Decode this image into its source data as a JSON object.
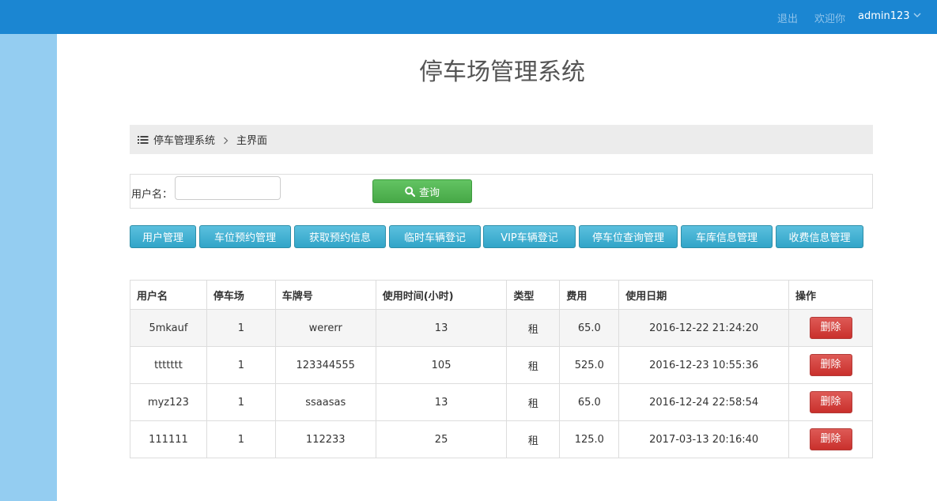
{
  "header": {
    "logout": "退出",
    "welcome": "欢迎你",
    "username": "admin123"
  },
  "page": {
    "title": "停车场管理系统"
  },
  "breadcrumb": {
    "root": "停车管理系统",
    "current": "主界面"
  },
  "search": {
    "label": "用户名：",
    "value": "",
    "button": "查询"
  },
  "nav": [
    {
      "label": "用户管理"
    },
    {
      "label": "车位预约管理"
    },
    {
      "label": "获取预约信息"
    },
    {
      "label": "临时车辆登记"
    },
    {
      "label": "VIP车辆登记"
    },
    {
      "label": "停车位查询管理"
    },
    {
      "label": "车库信息管理"
    },
    {
      "label": "收费信息管理"
    }
  ],
  "table": {
    "columns": [
      "用户名",
      "停车场",
      "车牌号",
      "使用时间(小时)",
      "类型",
      "费用",
      "使用日期",
      "操作"
    ],
    "rows": [
      {
        "user": "5mkauf",
        "lot": "1",
        "plate": "wererr",
        "hours": "13",
        "type": "租",
        "fee": "65.0",
        "date": "2016-12-22 21:24:20",
        "action": "删除"
      },
      {
        "user": "ttttttt",
        "lot": "1",
        "plate": "123344555",
        "hours": "105",
        "type": "租",
        "fee": "525.0",
        "date": "2016-12-23 10:55:36",
        "action": "删除"
      },
      {
        "user": "myz123",
        "lot": "1",
        "plate": "ssaasas",
        "hours": "13",
        "type": "租",
        "fee": "65.0",
        "date": "2016-12-24 22:58:54",
        "action": "删除"
      },
      {
        "user": "111111",
        "lot": "1",
        "plate": "112233",
        "hours": "25",
        "type": "租",
        "fee": "125.0",
        "date": "2017-03-13 20:16:40",
        "action": "删除"
      }
    ]
  },
  "colors": {
    "topbar": "#1b86d2",
    "sidebar": "#94cdf1",
    "search_button": "#46a846",
    "nav_button": "#31a5c8",
    "delete_button": "#c9302c"
  },
  "icons": [
    "list-icon",
    "chevron-right-icon",
    "search-icon",
    "chevron-down-icon"
  ]
}
